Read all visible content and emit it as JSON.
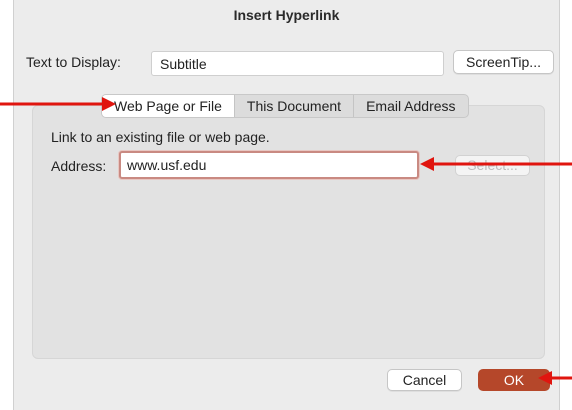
{
  "dialog": {
    "title": "Insert Hyperlink"
  },
  "display": {
    "label": "Text to Display:",
    "value": "Subtitle",
    "screentip_label": "ScreenTip..."
  },
  "tabs": [
    {
      "label": "Web Page or File",
      "active": true
    },
    {
      "label": "This Document",
      "active": false
    },
    {
      "label": "Email Address",
      "active": false
    }
  ],
  "panel": {
    "instruction": "Link to an existing file or web page.",
    "address_label": "Address:",
    "address_value": "www.usf.edu",
    "select_label": "Select..."
  },
  "footer": {
    "cancel_label": "Cancel",
    "ok_label": "OK"
  },
  "colors": {
    "annotation_arrow": "#e0150f",
    "ok_button": "#b5472a",
    "address_focus_border": "#c98a82"
  },
  "annotations": [
    {
      "icon": "arrow-right-icon",
      "target": "tab-web-page-or-file"
    },
    {
      "icon": "arrow-left-icon",
      "target": "address-input"
    },
    {
      "icon": "arrow-left-icon",
      "target": "ok-button"
    }
  ]
}
